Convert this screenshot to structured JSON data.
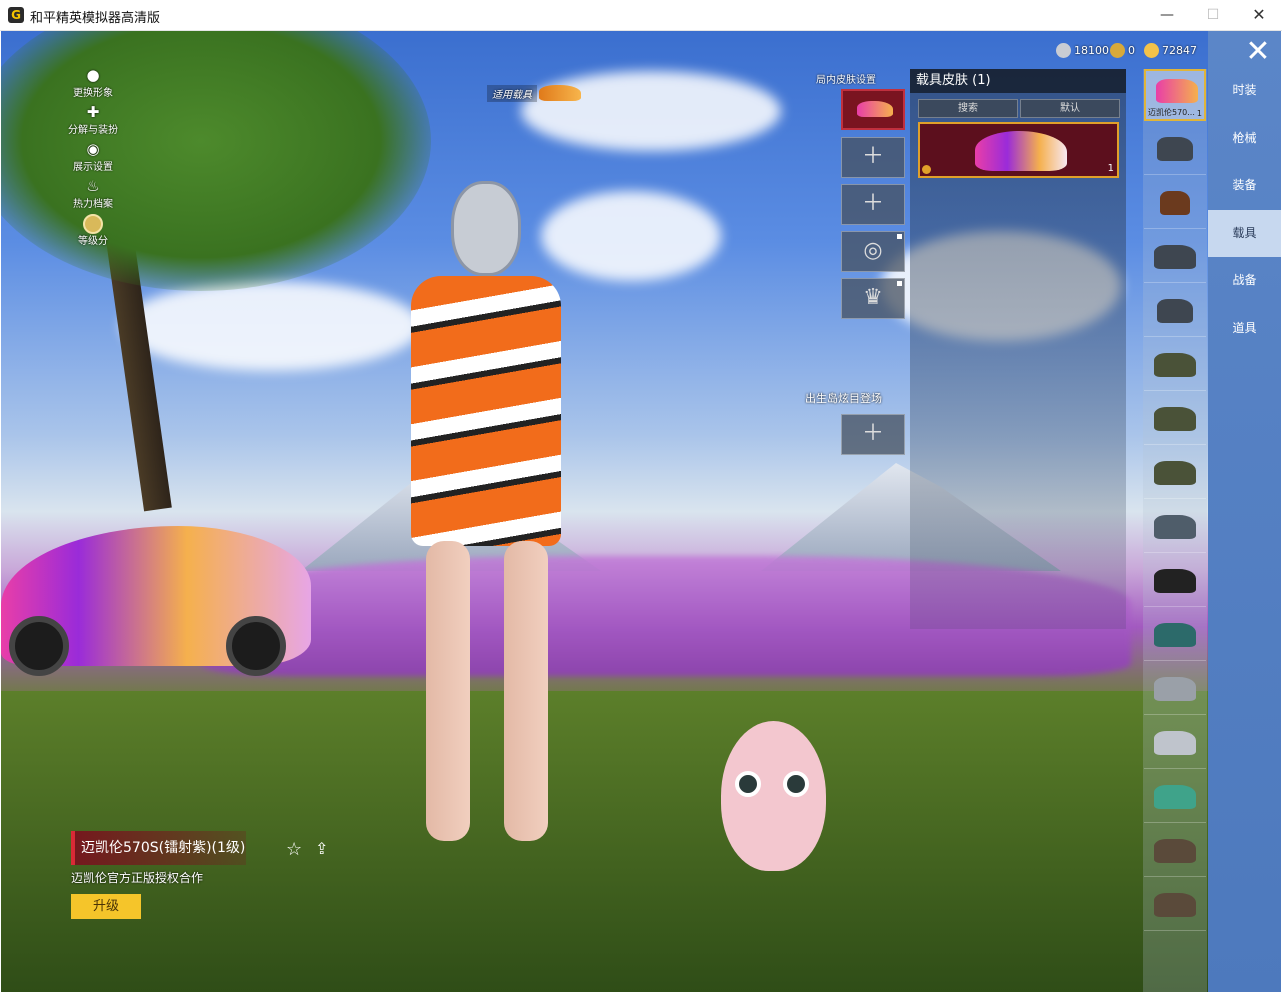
{
  "window": {
    "title": "和平精英模拟器高清版",
    "min_glyph": "—",
    "max_glyph": "☐",
    "close_glyph": "✕"
  },
  "side_menu": [
    {
      "label": "更换形象",
      "icon": "person-icon"
    },
    {
      "label": "分解与装扮",
      "icon": "puzzle-icon"
    },
    {
      "label": "展示设置",
      "icon": "eye-icon"
    },
    {
      "label": "热力档案",
      "icon": "flame-icon"
    },
    {
      "label": "等级分",
      "icon": "rank-badge-icon"
    }
  ],
  "apply_vehicle_label": "适用载具",
  "currency": [
    {
      "icon": "silver-coin-icon",
      "value": "18100",
      "color": "#c9ccd3"
    },
    {
      "icon": "token-icon",
      "value": "0",
      "color": "#d8a93a"
    },
    {
      "icon": "gold-coin-icon",
      "value": "72847",
      "color": "#f3c24a"
    }
  ],
  "slots_title": "局内皮肤设置",
  "spawn_title": "出生岛炫目登场",
  "slot_plus": "＋",
  "skin_panel": {
    "title": "载具皮肤 (1)",
    "search_placeholder": "搜索",
    "sort_label": "默认",
    "card_count": "1"
  },
  "vehicle_list": [
    {
      "label": "迈凯伦570...",
      "count": "1",
      "icon": "mclaren-car-icon"
    },
    {
      "label": "",
      "icon": "motorcycle-icon"
    },
    {
      "label": "",
      "icon": "horse-icon"
    },
    {
      "label": "",
      "icon": "buggy-icon"
    },
    {
      "label": "",
      "icon": "dirt-bike-icon"
    },
    {
      "label": "",
      "icon": "uaz-jeep-icon"
    },
    {
      "label": "",
      "icon": "uaz-jeep-icon"
    },
    {
      "label": "",
      "icon": "uaz-jeep-icon"
    },
    {
      "label": "",
      "icon": "sedan-icon"
    },
    {
      "label": "",
      "icon": "monster-truck-icon"
    },
    {
      "label": "",
      "icon": "coupe-icon"
    },
    {
      "label": "",
      "icon": "muscle-car-icon"
    },
    {
      "label": "",
      "icon": "pickup-icon"
    },
    {
      "label": "",
      "icon": "van-icon"
    },
    {
      "label": "",
      "icon": "pickup-icon"
    },
    {
      "label": "",
      "icon": "pickup-icon"
    }
  ],
  "categories": [
    "时装",
    "枪械",
    "装备",
    "载具",
    "战备",
    "道具"
  ],
  "selected_category": "载具",
  "skin_info": {
    "name": "迈凯伦570S(镭射紫)(1级)",
    "description": "迈凯伦官方正版授权合作",
    "upgrade_label": "升级"
  },
  "colors": {
    "accent_gold": "#f5c52a",
    "selected_red": "#7a1420",
    "category_blue": "#5b86c8"
  }
}
